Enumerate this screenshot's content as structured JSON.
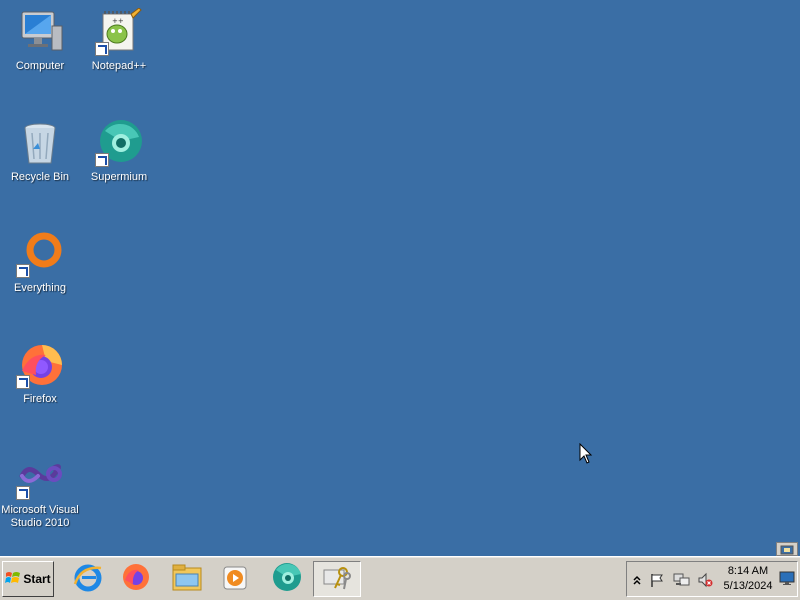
{
  "desktop_icons": [
    {
      "label": "Computer",
      "icon": "computer-icon",
      "shortcut": false
    },
    {
      "label": "Notepad++",
      "icon": "notepad-plus-plus-icon",
      "shortcut": true
    },
    {
      "label": "Recycle Bin",
      "icon": "recycle-bin-icon",
      "shortcut": false
    },
    {
      "label": "Supermium",
      "icon": "supermium-icon",
      "shortcut": true
    },
    {
      "label": "Everything",
      "icon": "everything-search-icon",
      "shortcut": true
    },
    {
      "label": "Firefox",
      "icon": "firefox-icon",
      "shortcut": true
    },
    {
      "label": "Microsoft Visual Studio 2010",
      "icon": "visual-studio-icon",
      "shortcut": true
    }
  ],
  "taskbar": {
    "start_label": "Start",
    "pinned": [
      {
        "icon": "internet-explorer-icon"
      },
      {
        "icon": "firefox-icon"
      },
      {
        "icon": "file-explorer-icon"
      },
      {
        "icon": "media-player-icon"
      },
      {
        "icon": "supermium-icon"
      },
      {
        "icon": "keys-icon",
        "active": true
      }
    ]
  },
  "tray": {
    "icons": [
      "show-hidden-icons-chevron",
      "action-center-flag-icon",
      "network-icon",
      "volume-muted-icon"
    ],
    "time": "8:14 AM",
    "date": "5/13/2024"
  },
  "colors": {
    "desktop_background": "#3a6ea5",
    "taskbar": "#d4d0c8"
  }
}
